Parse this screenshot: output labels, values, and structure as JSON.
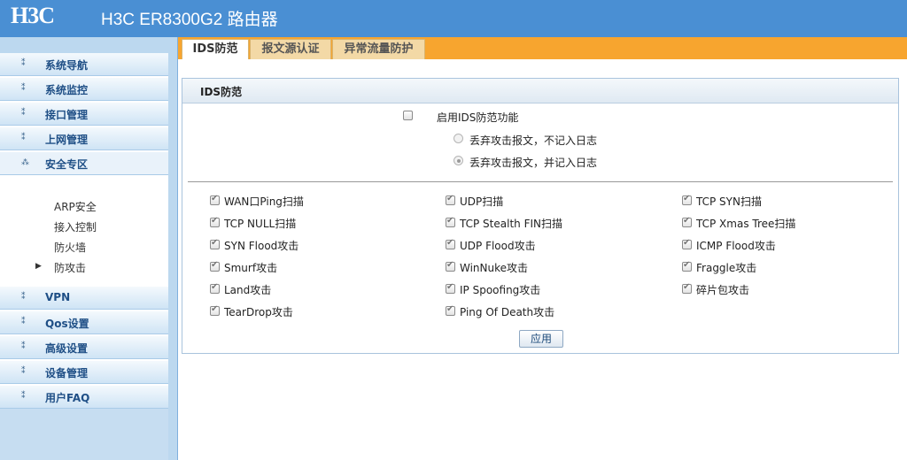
{
  "header": {
    "logo": "H3C",
    "title": "H3C ER8300G2 路由器"
  },
  "sidebar": {
    "items": [
      {
        "label": "系统导航"
      },
      {
        "label": "系统监控"
      },
      {
        "label": "接口管理"
      },
      {
        "label": "上网管理"
      },
      {
        "label": "安全专区",
        "expanded": true
      },
      {
        "label": "VPN"
      },
      {
        "label": "Qos设置"
      },
      {
        "label": "高级设置"
      },
      {
        "label": "设备管理"
      },
      {
        "label": "用户FAQ"
      }
    ],
    "subitems": [
      {
        "label": "ARP安全"
      },
      {
        "label": "接入控制"
      },
      {
        "label": "防火墙"
      },
      {
        "label": "防攻击",
        "active": true
      }
    ]
  },
  "tabs": [
    {
      "label": "IDS防范",
      "active": true
    },
    {
      "label": "报文源认证"
    },
    {
      "label": "异常流量防护"
    }
  ],
  "panel": {
    "title": "IDS防范",
    "enable": {
      "label": "启用IDS防范功能",
      "checked": false
    },
    "radios": [
      {
        "label": "丢弃攻击报文，不记入日志",
        "checked": false
      },
      {
        "label": "丢弃攻击报文，并记入日志",
        "checked": true
      }
    ],
    "options": [
      {
        "label": "WAN口Ping扫描",
        "checked": true
      },
      {
        "label": "UDP扫描",
        "checked": true
      },
      {
        "label": "TCP SYN扫描",
        "checked": true
      },
      {
        "label": "TCP NULL扫描",
        "checked": true
      },
      {
        "label": "TCP Stealth FIN扫描",
        "checked": true
      },
      {
        "label": "TCP Xmas Tree扫描",
        "checked": true
      },
      {
        "label": "SYN Flood攻击",
        "checked": true
      },
      {
        "label": "UDP Flood攻击",
        "checked": true
      },
      {
        "label": "ICMP Flood攻击",
        "checked": true
      },
      {
        "label": "Smurf攻击",
        "checked": true
      },
      {
        "label": "WinNuke攻击",
        "checked": true
      },
      {
        "label": "Fraggle攻击",
        "checked": true
      },
      {
        "label": "Land攻击",
        "checked": true
      },
      {
        "label": "IP Spoofing攻击",
        "checked": true
      },
      {
        "label": "碎片包攻击",
        "checked": true
      },
      {
        "label": "TearDrop攻击",
        "checked": true
      },
      {
        "label": "Ping Of Death攻击",
        "checked": true
      }
    ],
    "apply_label": "应用"
  },
  "colors": {
    "header": "#4a8fd3",
    "tabbar": "#f7a52f",
    "nav_text": "#1f4f86"
  }
}
